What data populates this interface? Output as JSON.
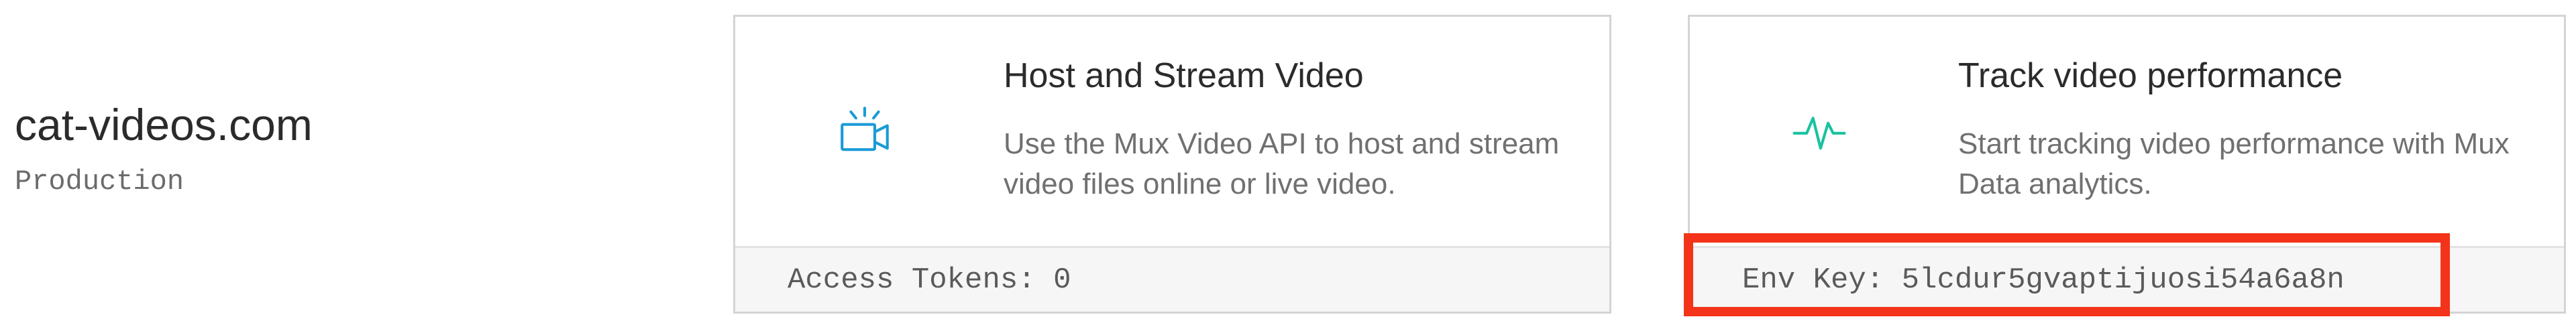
{
  "environment": {
    "name": "cat-videos.com",
    "label": "Production"
  },
  "cards": {
    "host": {
      "icon": "video-camera-icon",
      "title": "Host and Stream Video",
      "description": "Use the Mux Video API to host and stream video files online or live video.",
      "footer_label": "Access Tokens:",
      "footer_value": "0"
    },
    "data": {
      "icon": "pulse-icon",
      "title": "Track video performance",
      "description": "Start tracking video performance with Mux Data analytics.",
      "footer_label": "Env Key:",
      "footer_value": "5lcdur5gvaptijuosi54a6a8n"
    }
  },
  "colors": {
    "video_icon": "#1a9bd7",
    "data_icon": "#19c2a0",
    "highlight": "#f3341a"
  }
}
